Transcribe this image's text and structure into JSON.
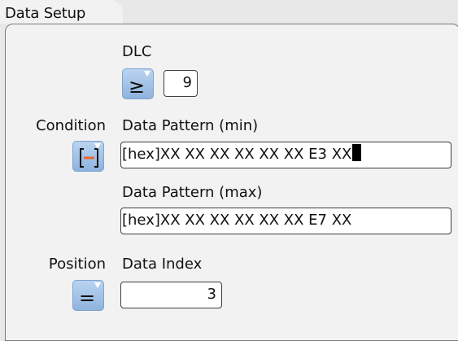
{
  "tab": {
    "title": "Data Setup"
  },
  "dlc": {
    "label": "DLC",
    "operator_icon": "greater-or-equal",
    "operator_symbol": "≥",
    "value": "9"
  },
  "condition": {
    "label": "Condition",
    "operator_icon": "in-range-bracket"
  },
  "pattern_min": {
    "label": "Data Pattern (min)",
    "value": "[hex]XX XX XX XX XX XX E3 XX"
  },
  "pattern_max": {
    "label": "Data Pattern (max)",
    "value": "[hex]XX XX XX XX XX XX E7 XX"
  },
  "position": {
    "label": "Position",
    "operator_icon": "equals",
    "operator_symbol": "="
  },
  "data_index": {
    "label": "Data Index",
    "value": "3"
  },
  "colors": {
    "background": "#e8e8e8",
    "panel": "#f2f2f2",
    "button_blue": "#a6c4e8",
    "accent_orange": "#e8682a",
    "field_border": "#3f3f3f"
  }
}
